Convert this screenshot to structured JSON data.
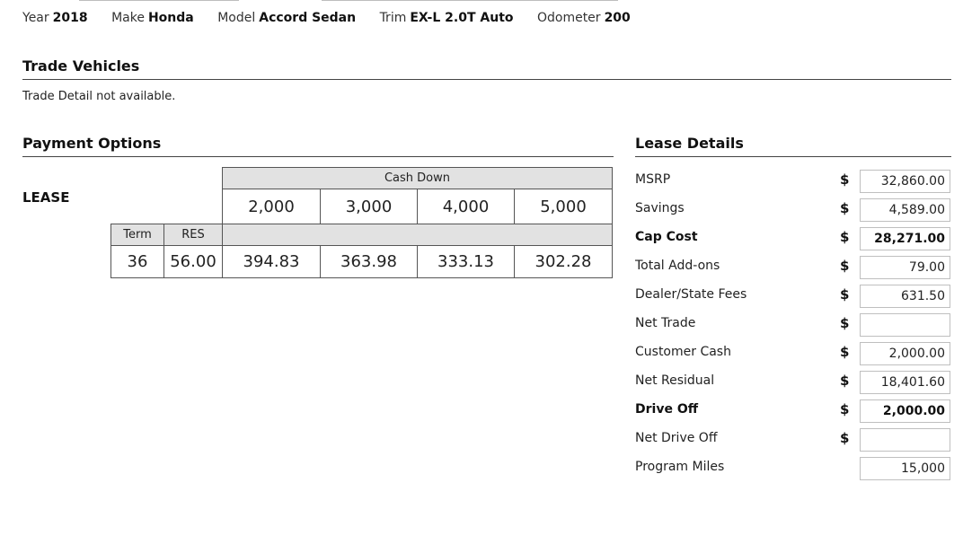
{
  "vehicle": {
    "year_label": "Year",
    "year": "2018",
    "make_label": "Make",
    "make": "Honda",
    "model_label": "Model",
    "model": "Accord Sedan",
    "trim_label": "Trim",
    "trim": "EX-L 2.0T Auto",
    "odometer_label": "Odometer",
    "odometer": "200"
  },
  "trade": {
    "title": "Trade Vehicles",
    "message": "Trade Detail not available."
  },
  "payment": {
    "title": "Payment Options",
    "lease_label": "LEASE",
    "cash_down_header": "Cash Down",
    "cash_down": [
      "2,000",
      "3,000",
      "4,000",
      "5,000"
    ],
    "term_header": "Term",
    "res_header": "RES",
    "rows": [
      {
        "term": "36",
        "res": "56.00",
        "payments": [
          "394.83",
          "363.98",
          "333.13",
          "302.28"
        ]
      }
    ]
  },
  "lease_details": {
    "title": "Lease Details",
    "rows": [
      {
        "label": "MSRP",
        "currency": "$",
        "value": "32,860.00",
        "bold": false
      },
      {
        "label": "Savings",
        "currency": "$",
        "value": "4,589.00",
        "bold": false
      },
      {
        "label": "Cap Cost",
        "currency": "$",
        "value": "28,271.00",
        "bold": true
      },
      {
        "label": "Total Add-ons",
        "currency": "$",
        "value": "79.00",
        "bold": false
      },
      {
        "label": "Dealer/State Fees",
        "currency": "$",
        "value": "631.50",
        "bold": false
      },
      {
        "label": "Net Trade",
        "currency": "$",
        "value": "",
        "bold": false
      },
      {
        "label": "Customer Cash",
        "currency": "$",
        "value": "2,000.00",
        "bold": false
      },
      {
        "label": "Net Residual",
        "currency": "$",
        "value": "18,401.60",
        "bold": false
      },
      {
        "label": "Drive Off",
        "currency": "$",
        "value": "2,000.00",
        "bold": true
      },
      {
        "label": "Net Drive Off",
        "currency": "$",
        "value": "",
        "bold": false
      },
      {
        "label": "Program Miles",
        "currency": "",
        "value": "15,000",
        "bold": false
      }
    ]
  }
}
